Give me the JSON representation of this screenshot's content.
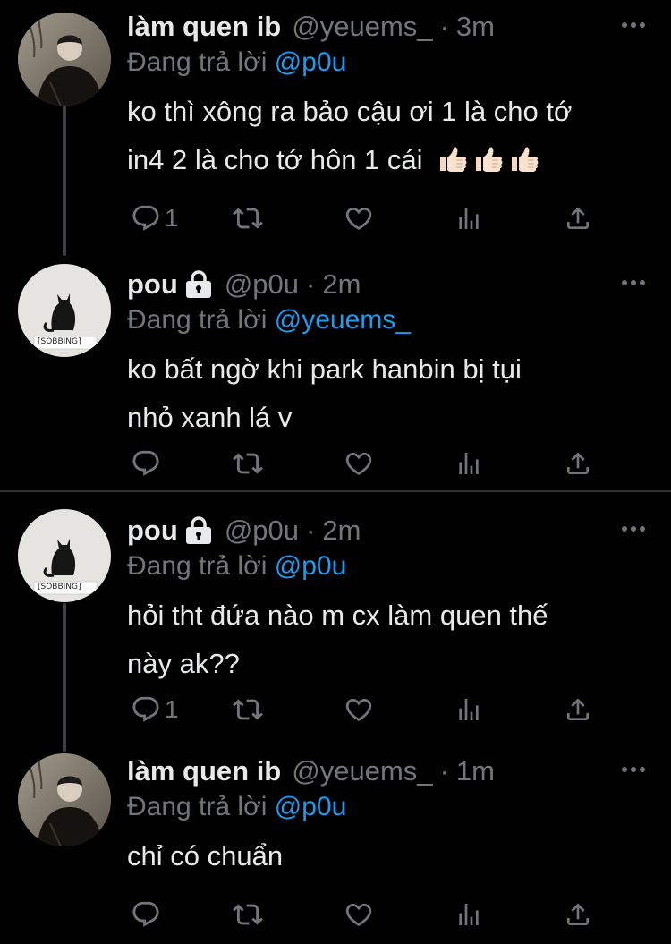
{
  "tweets": [
    {
      "display_name": "làm quen ib",
      "handle": "@yeuems_",
      "separator": "·",
      "time": "3m",
      "reply_prefix": "Đang trả lời",
      "reply_to": "@p0u",
      "text_lines": [
        "ko thì xông ra bảo cậu ơi 1 là cho tớ",
        "in4 2 là cho tớ hôn 1 cái"
      ],
      "emoji": [
        "thumbs-up",
        "thumbs-up",
        "thumbs-up"
      ],
      "reply_count": "1",
      "protected": false,
      "avatar": "person-photo"
    },
    {
      "display_name": "pou",
      "handle": "@p0u",
      "separator": "·",
      "time": "2m",
      "reply_prefix": "Đang trả lời",
      "reply_to": "@yeuems_",
      "text_lines": [
        "ko bất ngờ khi park hanbin bị tụi",
        "nhỏ xanh lá v"
      ],
      "reply_count": "",
      "protected": true,
      "avatar": "cat-photo",
      "avatar_caption": "[SOBBING]"
    },
    {
      "display_name": "pou",
      "handle": "@p0u",
      "separator": "·",
      "time": "2m",
      "reply_prefix": "Đang trả lời",
      "reply_to": "@p0u",
      "text_lines": [
        "hỏi tht đứa nào m cx làm quen thế",
        "này ak??"
      ],
      "reply_count": "1",
      "protected": true,
      "avatar": "cat-photo",
      "avatar_caption": "[SOBBING]"
    },
    {
      "display_name": "làm quen ib",
      "handle": "@yeuems_",
      "separator": "·",
      "time": "1m",
      "reply_prefix": "Đang trả lời",
      "reply_to": "@p0u",
      "text_lines": [
        "chỉ có chuẩn"
      ],
      "reply_count": "",
      "protected": false,
      "avatar": "person-photo"
    }
  ],
  "icons": {
    "reply": "reply-icon",
    "retweet": "retweet-icon",
    "like": "like-icon",
    "analytics": "analytics-icon",
    "share": "share-icon",
    "more": "more-icon",
    "lock": "lock-icon"
  },
  "colors": {
    "background": "#000000",
    "text": "#e7e9ea",
    "secondary": "#71767b",
    "mention": "#1d9bf0",
    "divider": "#2f3336"
  }
}
